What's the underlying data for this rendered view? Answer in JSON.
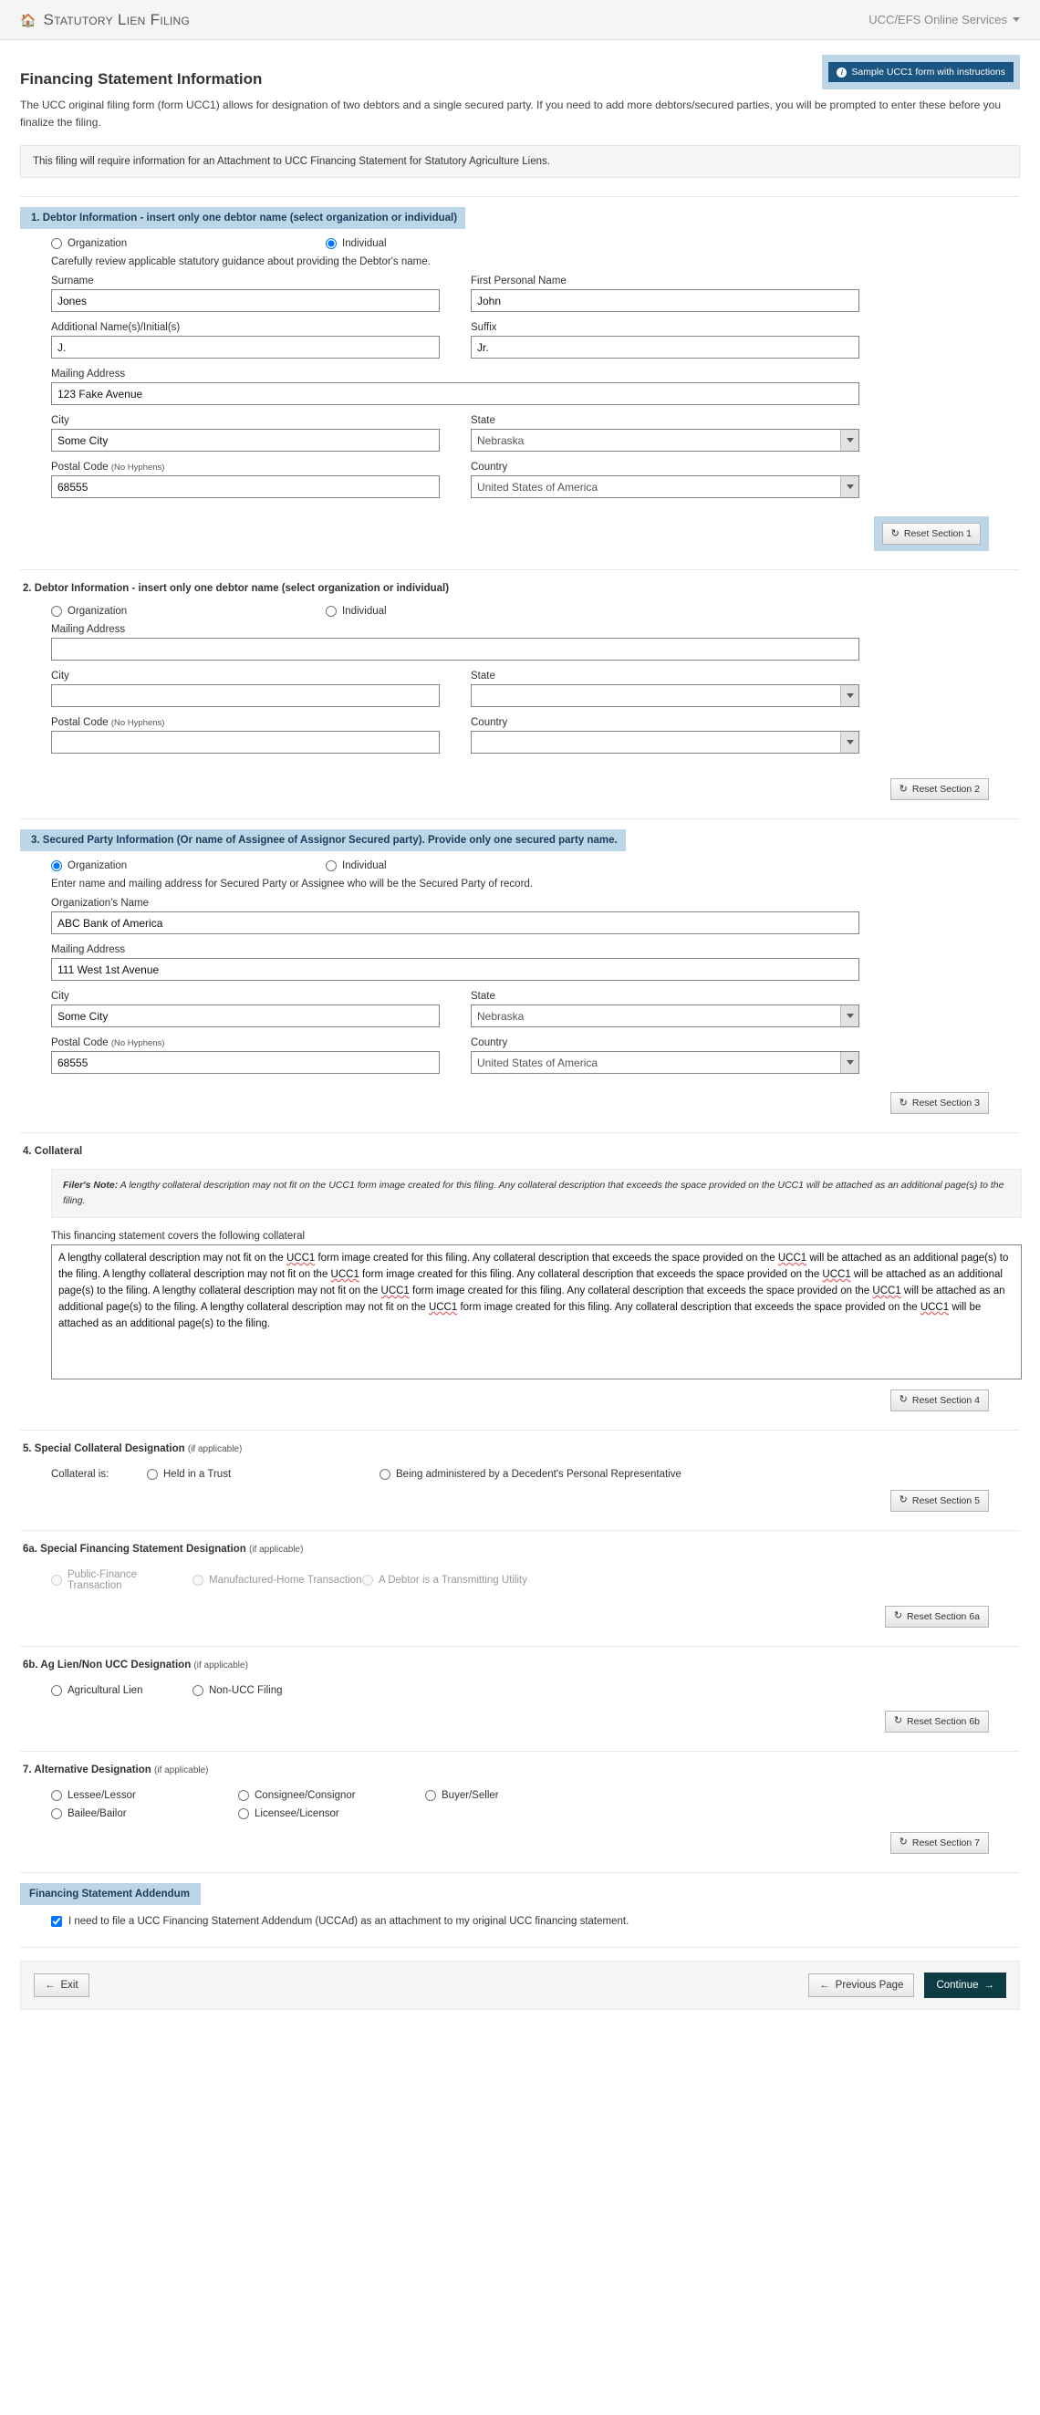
{
  "header": {
    "home_icon": "home-icon",
    "brand_title": "Statutory Lien Filing",
    "services_menu": "UCC/EFS Online Services"
  },
  "sample_button": {
    "label": "Sample UCC1 form with instructions",
    "icon": "info-circle-icon"
  },
  "page": {
    "title": "Financing Statement Information",
    "intro": "The UCC original filing form (form UCC1) allows for designation of two debtors and a single secured party. If you need to add more debtors/secured parties, you will be prompted to enter these before you finalize the filing.",
    "notice": "This filing will require information for an Attachment to UCC Financing Statement for Statutory Agriculture Liens."
  },
  "section1": {
    "heading": "1. Debtor Information - insert only one debtor name (select organization or individual)",
    "org_label": "Organization",
    "individual_label": "Individual",
    "selected": "Individual",
    "guidance": "Carefully review applicable statutory guidance about providing the Debtor's name.",
    "surname_label": "Surname",
    "surname_value": "Jones",
    "first_name_label": "First Personal Name",
    "first_name_value": "John",
    "additional_label": "Additional Name(s)/Initial(s)",
    "additional_value": "J.",
    "suffix_label": "Suffix",
    "suffix_value": "Jr.",
    "mailing_label": "Mailing Address",
    "mailing_value": "123 Fake Avenue",
    "city_label": "City",
    "city_value": "Some City",
    "state_label": "State",
    "state_value": "Nebraska",
    "postal_label": "Postal Code",
    "postal_label_small": "(No Hyphens)",
    "postal_value": "68555",
    "country_label": "Country",
    "country_value": "United States of America",
    "reset_label": "Reset Section 1"
  },
  "section2": {
    "heading": "2. Debtor Information - insert only one debtor name (select organization or individual)",
    "org_label": "Organization",
    "individual_label": "Individual",
    "selected": "",
    "mailing_label": "Mailing Address",
    "mailing_value": "",
    "city_label": "City",
    "city_value": "",
    "state_label": "State",
    "state_value": "",
    "postal_label": "Postal Code",
    "postal_label_small": "(No Hyphens)",
    "postal_value": "",
    "country_label": "Country",
    "country_value": "",
    "reset_label": "Reset Section 2"
  },
  "section3": {
    "heading": "3. Secured Party Information (Or name of Assignee of Assignor Secured party). Provide only one secured party name.",
    "org_label": "Organization",
    "individual_label": "Individual",
    "selected": "Organization",
    "guidance": "Enter name and mailing address for Secured Party or Assignee who will be the Secured Party of record.",
    "org_name_label": "Organization's Name",
    "org_name_value": "ABC Bank of America",
    "mailing_label": "Mailing Address",
    "mailing_value": "111 West 1st Avenue",
    "city_label": "City",
    "city_value": "Some City",
    "state_label": "State",
    "state_value": "Nebraska",
    "postal_label": "Postal Code",
    "postal_label_small": "(No Hyphens)",
    "postal_value": "68555",
    "country_label": "Country",
    "country_value": "United States of America",
    "reset_label": "Reset Section 3"
  },
  "section4": {
    "heading": "4. Collateral",
    "filer_note_bold": "Filer's Note:",
    "filer_note": " A lengthy collateral description may not fit on the UCC1 form image created for this filing. Any collateral description that exceeds the space provided on the UCC1 will be attached as an additional page(s) to the filing.",
    "textarea_label": "This financing statement covers the following collateral",
    "textarea_value": "A lengthy collateral description may not fit on the UCC1 form image created for this filing. Any collateral description that exceeds the space provided on the UCC1 will be attached as an additional page(s) to the filing. A lengthy collateral description may not fit on the UCC1 form image created for this filing. Any collateral description that exceeds the space provided on the UCC1 will be attached as an additional page(s) to the filing. A lengthy collateral description may not fit on the UCC1 form image created for this filing. Any collateral description that exceeds the space provided on the UCC1 will be attached as an additional page(s) to the filing. A lengthy collateral description may not fit on the UCC1 form image created for this filing. Any collateral description that exceeds the space provided on the UCC1 will be attached as an additional page(s) to the filing.",
    "reset_label": "Reset Section 4"
  },
  "section5": {
    "heading": "5. Special Collateral Designation",
    "heading_small": "(if applicable)",
    "prompt": "Collateral is:",
    "option1": "Held in a Trust",
    "option2": "Being administered by a Decedent's Personal Representative",
    "reset_label": "Reset Section 5"
  },
  "section6a": {
    "heading": "6a. Special Financing Statement Designation",
    "heading_small": "(if applicable)",
    "option1": "Public-Finance Transaction",
    "option2": "Manufactured-Home Transaction",
    "option3": "A Debtor is a Transmitting Utility",
    "reset_label": "Reset Section 6a"
  },
  "section6b": {
    "heading": "6b. Ag Lien/Non UCC Designation",
    "heading_small": "(if applicable)",
    "option1": "Agricultural Lien",
    "option2": "Non-UCC Filing",
    "reset_label": "Reset Section 6b"
  },
  "section7": {
    "heading": "7. Alternative Designation",
    "heading_small": "(if applicable)",
    "option1": "Lessee/Lessor",
    "option2": "Consignee/Consignor",
    "option3": "Buyer/Seller",
    "option4": "Bailee/Bailor",
    "option5": "Licensee/Licensor",
    "reset_label": "Reset Section 7"
  },
  "addendum": {
    "heading": "Financing Statement Addendum",
    "checkbox_label": "I need to file a UCC Financing Statement Addendum (UCCAd) as an attachment to my original UCC financing statement.",
    "checked": true
  },
  "footer": {
    "exit_label": "Exit",
    "previous_label": "Previous Page",
    "continue_label": "Continue"
  },
  "colors": {
    "section_header_bg": "#bcd6e8",
    "section_header_text": "#1b3c59",
    "sample_btn_bg": "#1b5582",
    "continue_btn_bg": "#0d3c45",
    "topbar_bg": "#f5f5f5"
  }
}
